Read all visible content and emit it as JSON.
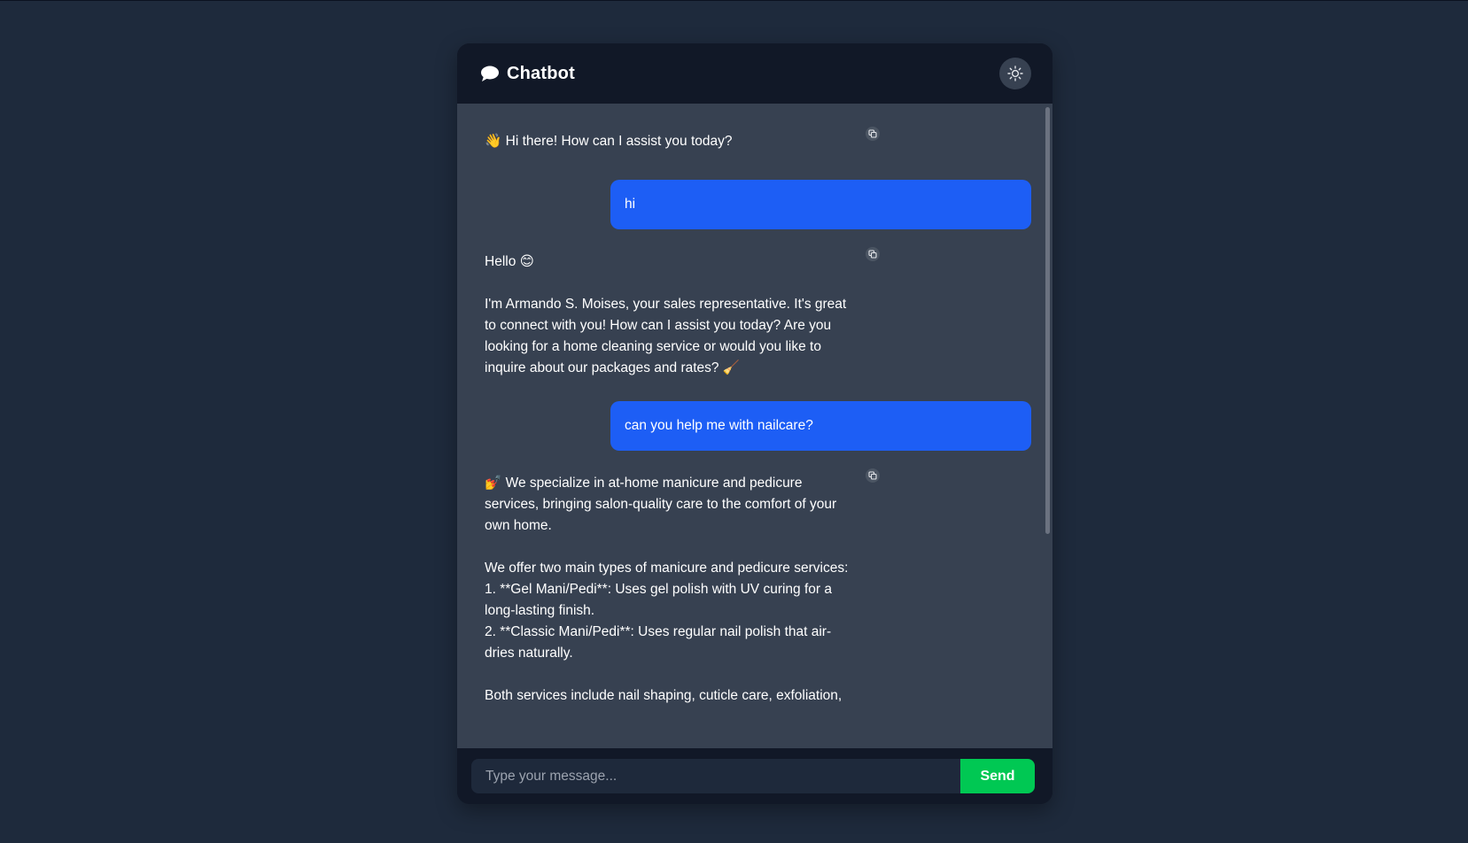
{
  "app": {
    "title": "Chatbot",
    "title_icon": "chat-bubble-icon",
    "theme_toggle_icon": "sun-icon"
  },
  "colors": {
    "page_background": "#1e2a3c",
    "panel_dark": "#111827",
    "messages_background": "#374151",
    "user_bubble": "#1d5ef5",
    "send_button": "#00c853"
  },
  "messages": [
    {
      "role": "bot",
      "emoji": "👋",
      "paragraphs": [
        "Hi there! How can I assist you today?"
      ],
      "copy_icon": "copy-icon"
    },
    {
      "role": "user",
      "text": "hi"
    },
    {
      "role": "bot",
      "paragraphs": [
        "Hello 😊",
        "",
        "I'm Armando S. Moises, your sales representative. It's great to connect with you! How can I assist you today? Are you looking for a home cleaning service or would you like to inquire about our packages and rates? 🧹"
      ],
      "copy_icon": "copy-icon"
    },
    {
      "role": "user",
      "text": "can you help me with nailcare?"
    },
    {
      "role": "bot",
      "paragraphs": [
        "💅 We specialize in at-home manicure and pedicure services, bringing salon-quality care to the comfort of your own home.",
        "",
        "We offer two main types of manicure and pedicure services:",
        "1. **Gel Mani/Pedi**: Uses gel polish with UV curing for a long-lasting finish.",
        "2. **Classic Mani/Pedi**: Uses regular nail polish that air-dries naturally.",
        "",
        "Both services include nail shaping, cuticle care, exfoliation,"
      ],
      "copy_icon": "copy-icon"
    }
  ],
  "composer": {
    "placeholder": "Type your message...",
    "value": "",
    "send_label": "Send"
  }
}
